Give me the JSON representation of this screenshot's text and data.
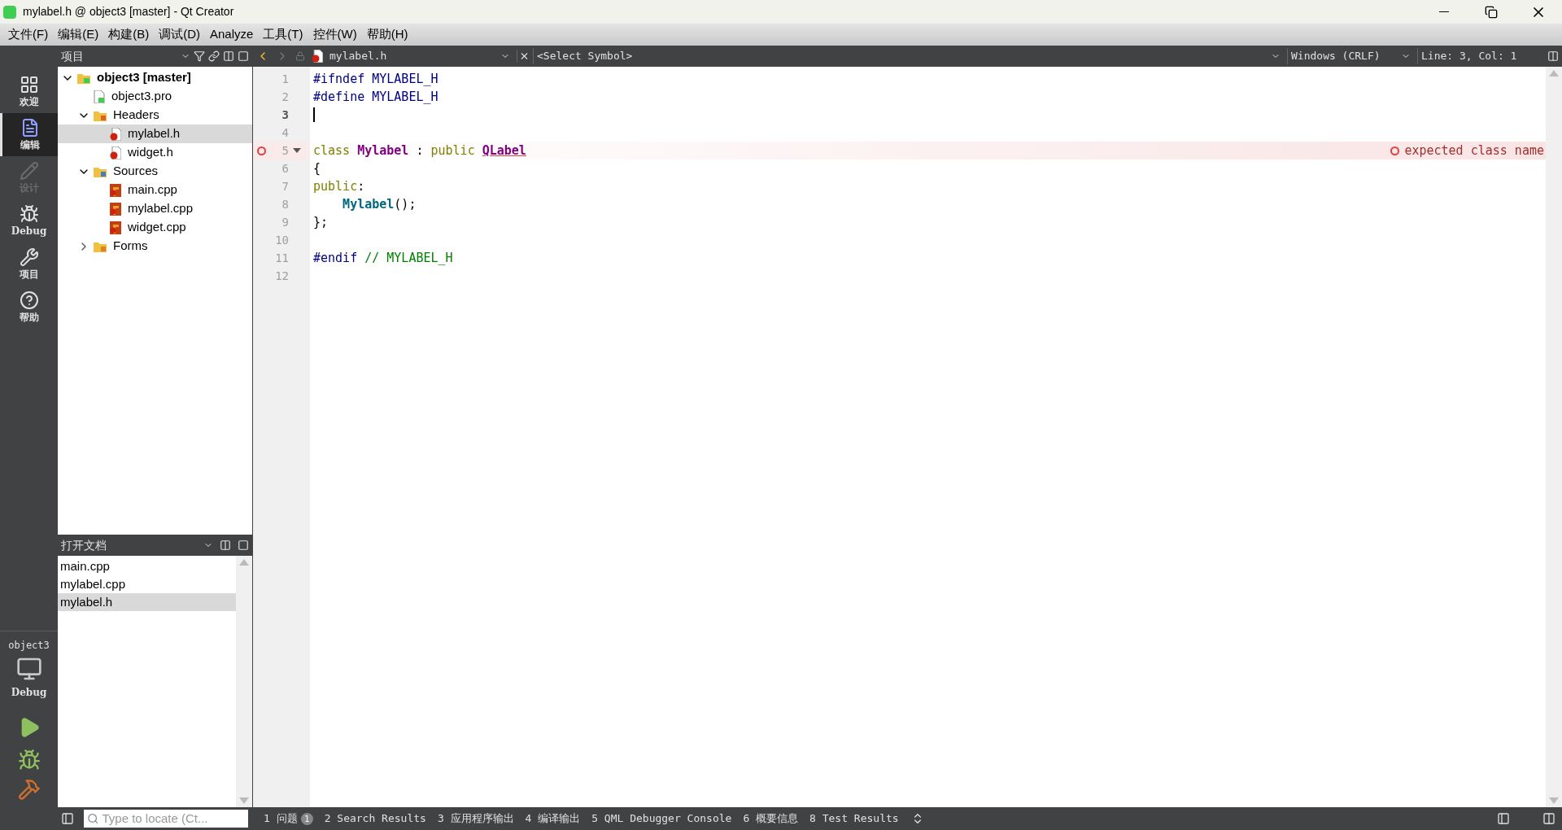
{
  "window": {
    "title": "mylabel.h @ object3 [master] - Qt Creator"
  },
  "menu": [
    "文件(F)",
    "编辑(E)",
    "构建(B)",
    "调试(D)",
    "Analyze",
    "工具(T)",
    "控件(W)",
    "帮助(H)"
  ],
  "modes": [
    {
      "kind": "welcome",
      "label": "欢迎",
      "selected": false,
      "disabled": false
    },
    {
      "kind": "edit",
      "label": "编辑",
      "selected": true,
      "disabled": false
    },
    {
      "kind": "design",
      "label": "设计",
      "selected": false,
      "disabled": true
    },
    {
      "kind": "debug",
      "label": "Debug",
      "selected": false,
      "disabled": false
    },
    {
      "kind": "projects",
      "label": "项目",
      "selected": false,
      "disabled": false
    },
    {
      "kind": "help",
      "label": "帮助",
      "selected": false,
      "disabled": false
    }
  ],
  "target": {
    "project": "object3",
    "config": "Debug"
  },
  "project_panel": {
    "title": "项目",
    "tree": [
      {
        "kind": "project",
        "label": "object3 [master]",
        "expanded": true,
        "selected": false,
        "children": [
          {
            "kind": "pro",
            "label": "object3.pro",
            "selected": false
          },
          {
            "kind": "folder-h",
            "label": "Headers",
            "expanded": true,
            "selected": false,
            "children": [
              {
                "kind": "header",
                "label": "mylabel.h",
                "selected": true
              },
              {
                "kind": "header",
                "label": "widget.h",
                "selected": false
              }
            ]
          },
          {
            "kind": "folder-src",
            "label": "Sources",
            "expanded": true,
            "selected": false,
            "children": [
              {
                "kind": "source",
                "label": "main.cpp",
                "selected": false
              },
              {
                "kind": "source",
                "label": "mylabel.cpp",
                "selected": false
              },
              {
                "kind": "source",
                "label": "widget.cpp",
                "selected": false
              }
            ]
          },
          {
            "kind": "folder-forms",
            "label": "Forms",
            "expanded": false,
            "selected": false
          }
        ]
      }
    ]
  },
  "open_documents": {
    "title": "打开文档",
    "items": [
      {
        "label": "main.cpp",
        "selected": false
      },
      {
        "label": "mylabel.cpp",
        "selected": false
      },
      {
        "label": "mylabel.h",
        "selected": true
      }
    ]
  },
  "editor_toolbar": {
    "file": "mylabel.h",
    "symbol": "<Select Symbol>",
    "line_ending": "Windows (CRLF)",
    "position": "Line: 3, Col: 1"
  },
  "editor": {
    "lines": [
      {
        "number": "1",
        "current": false,
        "tokens": [
          {
            "kind": "pre",
            "text": "#ifndef"
          },
          {
            "kind": "macro",
            "text": " MYLABEL_H"
          }
        ]
      },
      {
        "number": "2",
        "current": false,
        "tokens": [
          {
            "kind": "pre",
            "text": "#define"
          },
          {
            "kind": "macro",
            "text": " MYLABEL_H"
          }
        ]
      },
      {
        "number": "3",
        "current": true
      },
      {
        "number": "4",
        "current": false
      },
      {
        "number": "5",
        "current": false,
        "fold": true,
        "error": "expected class name",
        "tokens": [
          {
            "kind": "keyword",
            "text": "class"
          },
          {
            "kind": "type",
            "text": " Mylabel"
          },
          {
            "kind": "plain",
            "text": " : "
          },
          {
            "kind": "keyword",
            "text": "public "
          },
          {
            "kind": "error-type",
            "text": "QLabel"
          }
        ]
      },
      {
        "number": "6",
        "current": false,
        "tokens": [
          {
            "kind": "plain",
            "text": "{"
          }
        ]
      },
      {
        "number": "7",
        "current": false,
        "tokens": [
          {
            "kind": "keyword",
            "text": "public"
          },
          {
            "kind": "plain",
            "text": ":"
          }
        ]
      },
      {
        "number": "8",
        "current": false,
        "tokens": [
          {
            "kind": "func",
            "text": "    Mylabel"
          },
          {
            "kind": "plain",
            "text": "();"
          }
        ]
      },
      {
        "number": "9",
        "current": false,
        "tokens": [
          {
            "kind": "plain",
            "text": "};"
          }
        ]
      },
      {
        "number": "10",
        "current": false
      },
      {
        "number": "11",
        "current": false,
        "tokens": [
          {
            "kind": "pre",
            "text": "#endif"
          },
          {
            "kind": "comment",
            "text": " // MYLABEL_H"
          }
        ]
      },
      {
        "number": "12",
        "current": false
      }
    ]
  },
  "locator": {
    "placeholder": "Type to locate (Ct..."
  },
  "output_tabs": [
    {
      "label": "1 问题",
      "badge": "1"
    },
    {
      "label": "2 Search Results"
    },
    {
      "label": "3 应用程序输出"
    },
    {
      "label": "4 编译输出"
    },
    {
      "label": "5 QML Debugger Console"
    },
    {
      "label": "6 概要信息"
    },
    {
      "label": "8 Test Results"
    }
  ]
}
